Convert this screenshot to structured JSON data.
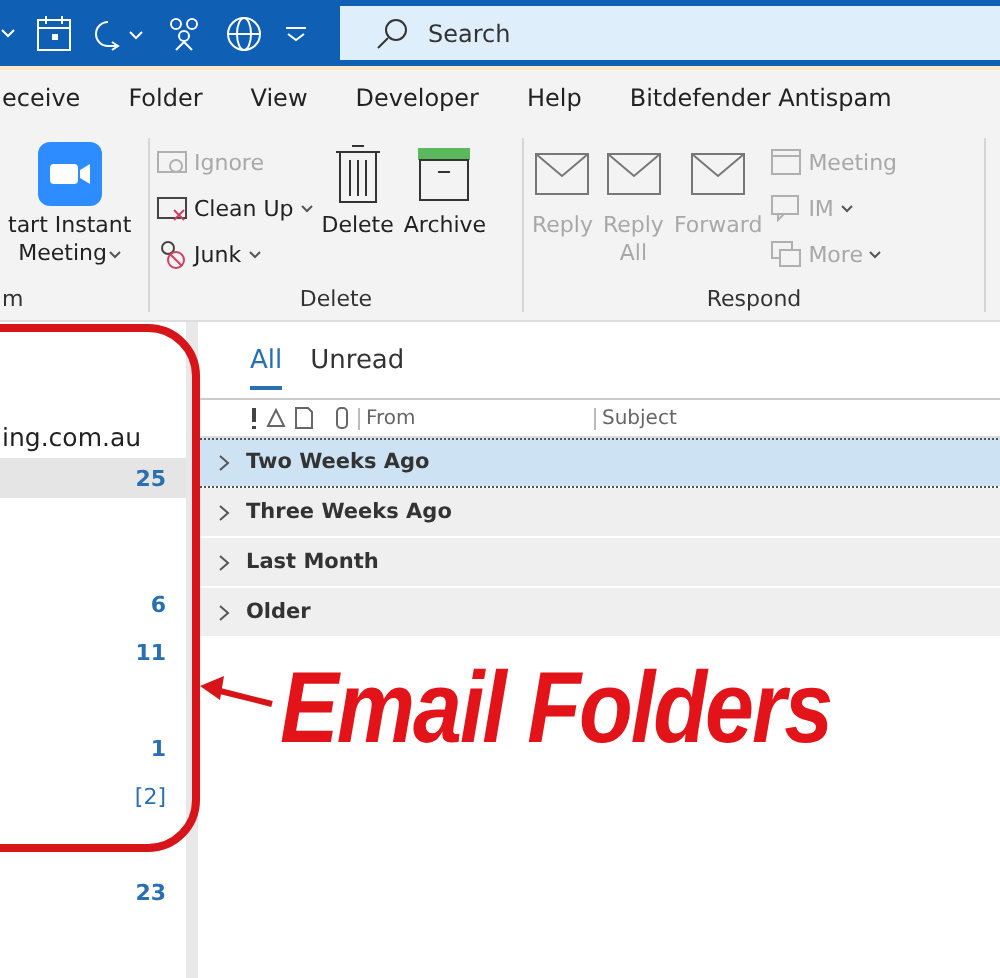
{
  "search": {
    "placeholder": "Search"
  },
  "ribbon_tabs": [
    {
      "label": "eceive",
      "selected": false
    },
    {
      "label": "Folder",
      "selected": false
    },
    {
      "label": "View",
      "selected": false
    },
    {
      "label": "Developer",
      "selected": false
    },
    {
      "label": "Help",
      "selected": false
    },
    {
      "label": "Bitdefender Antispam",
      "selected": false
    }
  ],
  "ribbon_groups": [
    {
      "label": "m",
      "big": [
        {
          "kind": "video",
          "label": "tart Instant\nMeeting",
          "caret": true,
          "disabled": false
        }
      ]
    },
    {
      "label": "Delete",
      "small": [
        {
          "kind": "ignore",
          "label": "Ignore",
          "caret": false,
          "disabled": true
        },
        {
          "kind": "cleanup",
          "label": "Clean Up",
          "caret": true,
          "disabled": false
        },
        {
          "kind": "junk",
          "label": "Junk",
          "caret": true,
          "disabled": false
        }
      ],
      "big": [
        {
          "kind": "trash",
          "label": "Delete",
          "caret": false,
          "disabled": false
        },
        {
          "kind": "archive",
          "label": "Archive",
          "caret": false,
          "disabled": false
        }
      ]
    },
    {
      "label": "Respond",
      "big": [
        {
          "kind": "mail",
          "label": "Reply",
          "caret": false,
          "disabled": true
        },
        {
          "kind": "mail",
          "label": "Reply\nAll",
          "caret": false,
          "disabled": true
        },
        {
          "kind": "mail",
          "label": "Forward",
          "caret": false,
          "disabled": true
        }
      ],
      "small": [
        {
          "kind": "meeting",
          "label": "Meeting",
          "caret": false,
          "disabled": true
        },
        {
          "kind": "im",
          "label": "IM",
          "caret": true,
          "disabled": true
        },
        {
          "kind": "more",
          "label": "More",
          "caret": true,
          "disabled": true
        }
      ]
    }
  ],
  "folders": [
    {
      "name": "ing.com.au",
      "selected": false
    },
    {
      "count": "25",
      "selected": true
    },
    {
      "count": "6",
      "selected": false
    },
    {
      "count": "11",
      "selected": false
    },
    {
      "count": "1",
      "selected": false
    },
    {
      "count": "[2]",
      "selected": false
    },
    {
      "count": "23",
      "selected": false
    }
  ],
  "filters": [
    {
      "label": "All",
      "selected": true
    },
    {
      "label": "Unread",
      "selected": false
    }
  ],
  "columns": [
    "From",
    "Subject"
  ],
  "groups": [
    {
      "label": "Two Weeks Ago",
      "selected": true
    },
    {
      "label": "Three Weeks Ago",
      "selected": false
    },
    {
      "label": "Last Month",
      "selected": false
    },
    {
      "label": "Older",
      "selected": false
    }
  ],
  "annotation": {
    "text": "Email Folders"
  }
}
